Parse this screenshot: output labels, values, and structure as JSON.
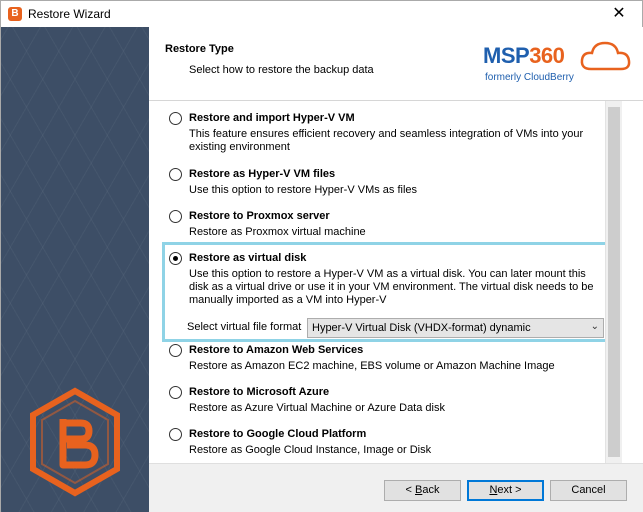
{
  "window": {
    "title": "Restore Wizard",
    "close_glyph": "✕"
  },
  "header": {
    "title": "Restore Type",
    "subtitle": "Select how to restore the backup data",
    "brand": {
      "name_part1": "MSP",
      "name_part2": "360",
      "tagline": "formerly CloudBerry"
    }
  },
  "options": [
    {
      "title": "Restore and import Hyper-V VM",
      "description": "This feature ensures efficient recovery and seamless integration of VMs into your existing environment",
      "checked": false
    },
    {
      "title": "Restore as Hyper-V VM files",
      "description": "Use this option to restore Hyper-V VMs as files",
      "checked": false
    },
    {
      "title": "Restore to Proxmox server",
      "description": "Restore as Proxmox virtual machine",
      "checked": false
    },
    {
      "title": "Restore as virtual disk",
      "description": "Use this option to restore a Hyper-V VM as a virtual disk. You can later mount this disk as a virtual drive or use it in your VM environment. The virtual disk needs to be manually imported as a VM into Hyper-V",
      "checked": true
    },
    {
      "title": "Restore to Amazon Web Services",
      "description": "Restore as Amazon EC2 machine, EBS volume or Amazon Machine Image",
      "checked": false
    },
    {
      "title": "Restore to Microsoft Azure",
      "description": "Restore as Azure Virtual Machine or Azure Data disk",
      "checked": false
    },
    {
      "title": "Restore to Google Cloud Platform",
      "description": "Restore as Google Cloud Instance, Image or Disk",
      "checked": false
    }
  ],
  "format": {
    "label": "Select virtual file format",
    "selected": "Hyper-V Virtual Disk (VHDX-format) dynamic"
  },
  "buttons": {
    "back_lt": "< ",
    "back_u": "B",
    "back_rest": "ack",
    "next_u": "N",
    "next_rest": "ext >",
    "cancel": "Cancel"
  },
  "colors": {
    "accent": "#0078d7",
    "brand_blue": "#1f5fae",
    "brand_orange": "#e8621e",
    "highlight": "#8fd3e6",
    "sidebar": "#3d4e66"
  }
}
